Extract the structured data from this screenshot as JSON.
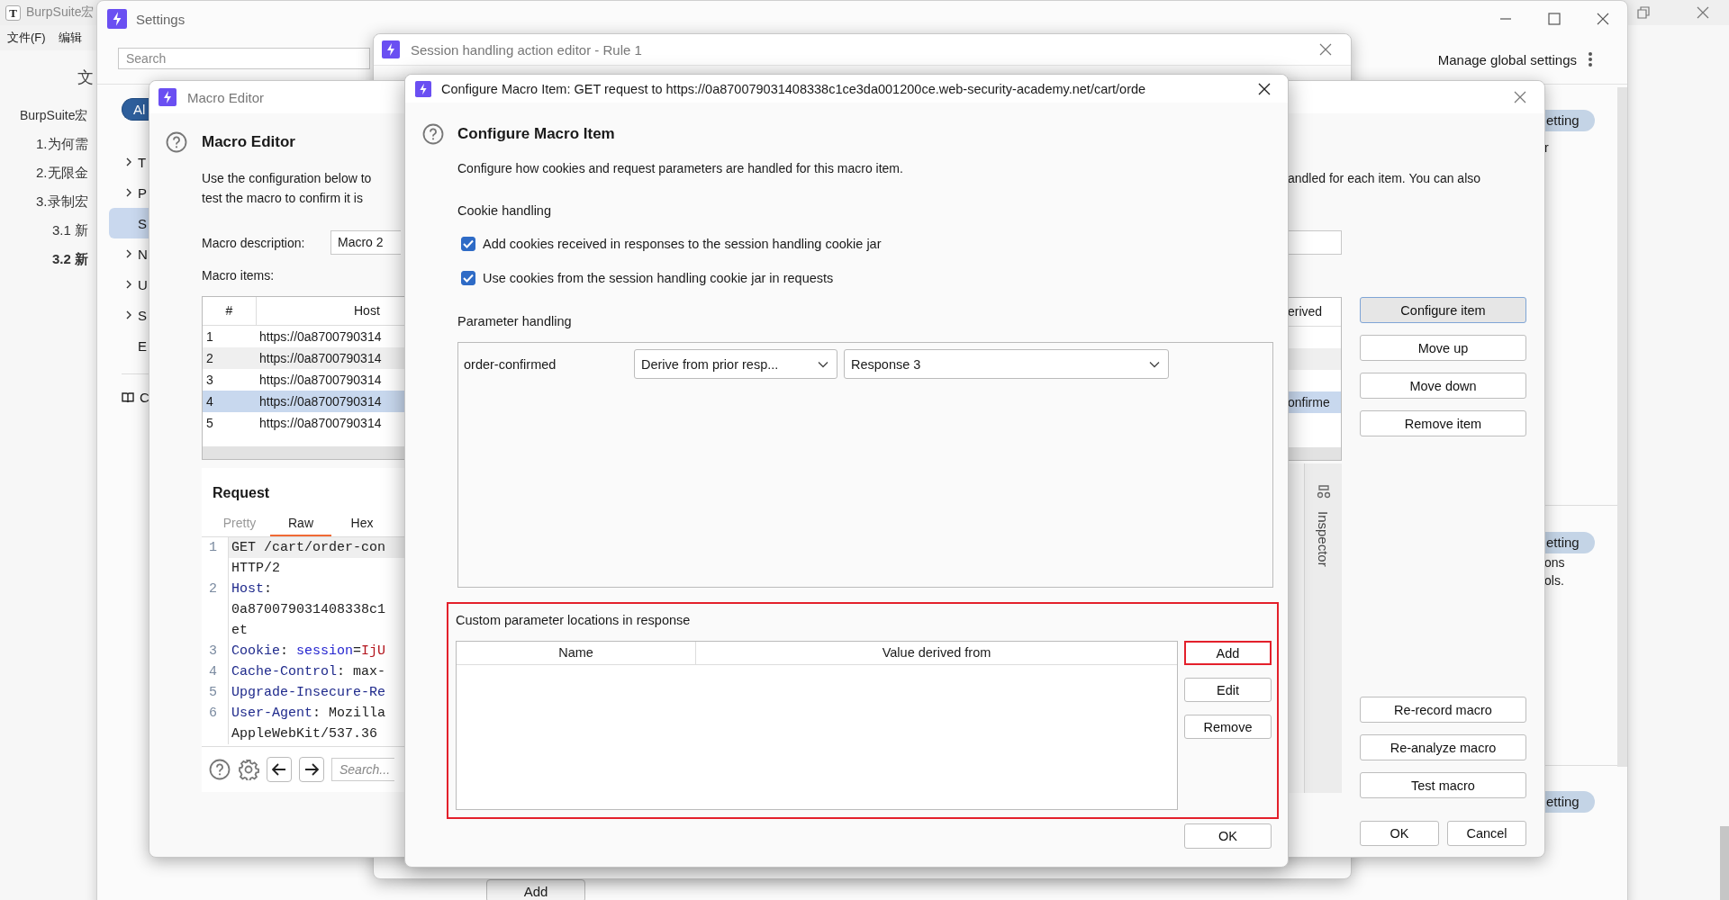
{
  "background_app": {
    "icon_letter": "T",
    "title": "BurpSuite宏",
    "menu": [
      "文件(F)",
      "编辑"
    ],
    "heading_fragment": "文",
    "outline": [
      {
        "text": "BurpSuite宏",
        "selected": false,
        "children": [
          {
            "text": "1.为何需",
            "selected": false
          },
          {
            "text": "2.无限金",
            "selected": false
          },
          {
            "text": "3.录制宏",
            "selected": false,
            "children": [
              {
                "text": "3.1 新",
                "selected": false
              },
              {
                "text": "3.2 新",
                "selected": true
              }
            ]
          }
        ]
      }
    ]
  },
  "settings": {
    "title": "Settings",
    "search": {
      "placeholder": "Search"
    },
    "manage_label": "Manage global settings",
    "filter_pill": "Al",
    "nav": [
      {
        "text": "T",
        "expandable": true,
        "selected": false
      },
      {
        "text": "P",
        "expandable": true,
        "selected": false
      },
      {
        "text": "S",
        "expandable": false,
        "selected": true
      },
      {
        "text": "N",
        "expandable": true,
        "selected": false
      },
      {
        "text": "U",
        "expandable": true,
        "selected": false
      },
      {
        "text": "S",
        "expandable": true,
        "selected": false
      },
      {
        "text": "E",
        "expandable": false,
        "selected": false
      }
    ],
    "docs_link": "C",
    "right_sections": [
      {
        "pill": "etting",
        "lines": [
          "r"
        ]
      },
      {
        "pill": "etting",
        "lines": [
          "ons",
          "ols."
        ]
      },
      {
        "pill": "etting"
      }
    ],
    "add_button": "Add"
  },
  "session_editor": {
    "title": "Session handling action editor - Rule 1"
  },
  "macro_editor": {
    "title": "Macro Editor",
    "heading": "Macro Editor",
    "description_left": [
      "Use the configuration below to",
      "test the macro to confirm it is"
    ],
    "description_right": "andled for each item. You can also",
    "macro_description": {
      "label": "Macro description:",
      "value": "Macro 2"
    },
    "items_label": "Macro items:",
    "items_table": {
      "columns": [
        "#",
        "Host"
      ],
      "derived_column": "erived",
      "rows": [
        {
          "number": "1",
          "host": "https://0a8700790314",
          "selected": false
        },
        {
          "number": "2",
          "host": "https://0a8700790314",
          "selected": false
        },
        {
          "number": "3",
          "host": "https://0a8700790314",
          "selected": false
        },
        {
          "number": "4",
          "host": "https://0a8700790314",
          "derived": "onfirme",
          "selected": true
        },
        {
          "number": "5",
          "host": "https://0a8700790314",
          "selected": false
        }
      ]
    },
    "request": {
      "title": "Request",
      "tabs": [
        {
          "label": "Pretty",
          "selected": false,
          "disabled": true
        },
        {
          "label": "Raw",
          "selected": true,
          "disabled": false
        },
        {
          "label": "Hex",
          "selected": false,
          "disabled": false
        }
      ],
      "lines": [
        {
          "number": "1",
          "segments": [
            {
              "text": "GET /cart/order-con",
              "kind": "value"
            }
          ]
        },
        {
          "segments": [
            {
              "text": "HTTP/2",
              "kind": "value"
            }
          ]
        },
        {
          "number": "2",
          "segments": [
            {
              "text": "Host",
              "kind": "header"
            },
            {
              "text": ":",
              "kind": "value"
            }
          ]
        },
        {
          "segments": [
            {
              "text": "0a870079031408338c1",
              "kind": "value"
            }
          ]
        },
        {
          "segments": [
            {
              "text": "et",
              "kind": "value"
            }
          ]
        },
        {
          "number": "3",
          "segments": [
            {
              "text": "Cookie",
              "kind": "header"
            },
            {
              "text": ": ",
              "kind": "value"
            },
            {
              "text": "session",
              "kind": "name"
            },
            {
              "text": "=",
              "kind": "value"
            },
            {
              "text": "IjU",
              "kind": "cookie"
            }
          ]
        },
        {
          "number": "4",
          "segments": [
            {
              "text": "Cache-Control",
              "kind": "header"
            },
            {
              "text": ": max-",
              "kind": "value"
            }
          ]
        },
        {
          "number": "5",
          "segments": [
            {
              "text": "Upgrade-Insecure-Re",
              "kind": "header"
            }
          ]
        },
        {
          "number": "6",
          "segments": [
            {
              "text": "User-Agent",
              "kind": "header"
            },
            {
              "text": ": Mozilla",
              "kind": "value"
            }
          ]
        },
        {
          "segments": [
            {
              "text": "AppleWebKit/537.36",
              "kind": "value"
            }
          ]
        }
      ],
      "search": {
        "placeholder": "Search..."
      }
    },
    "inspector": "Inspector",
    "side_buttons": [
      {
        "label": "Configure item",
        "focused": true
      },
      {
        "label": "Move up",
        "focused": false
      },
      {
        "label": "Move down",
        "focused": false
      },
      {
        "label": "Remove item",
        "focused": false
      }
    ],
    "macro_buttons": [
      "Re-record macro",
      "Re-analyze macro",
      "Test macro"
    ],
    "footer_buttons": [
      "OK",
      "Cancel"
    ]
  },
  "configure_dialog": {
    "title": "Configure Macro Item: GET request to https://0a870079031408338c1ce3da001200ce.web-security-academy.net/cart/orde",
    "heading": "Configure Macro Item",
    "description": "Configure how cookies and request parameters are handled for this macro item.",
    "cookie_section": {
      "title": "Cookie handling",
      "options": [
        {
          "label": "Add cookies received in responses to the session handling cookie jar",
          "checked": true
        },
        {
          "label": "Use cookies from the session handling cookie jar in requests",
          "checked": true
        }
      ]
    },
    "parameter_section": {
      "title": "Parameter handling",
      "parameters": [
        {
          "name": "order-confirmed",
          "source": "Derive from prior resp...",
          "response": "Response 3"
        }
      ]
    },
    "custom_locations": {
      "title": "Custom parameter locations in response",
      "highlighted": true,
      "columns": [
        "Name",
        "Value derived from"
      ],
      "buttons": [
        {
          "label": "Add",
          "highlighted": true
        },
        {
          "label": "Edit",
          "highlighted": false
        },
        {
          "label": "Remove",
          "highlighted": false
        }
      ]
    },
    "ok_button": "OK"
  }
}
